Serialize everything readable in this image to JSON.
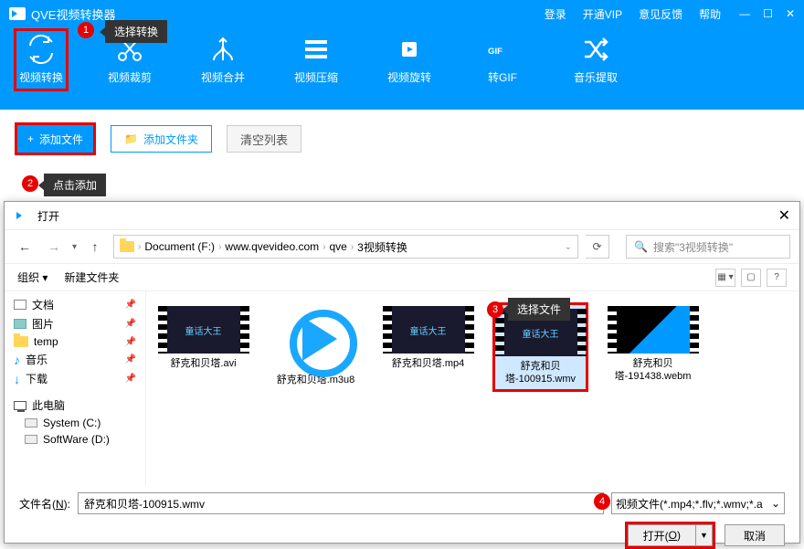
{
  "app_title": "QVE视频转换器",
  "titlebar_links": [
    "登录",
    "开通VIP",
    "意见反馈",
    "帮助"
  ],
  "tips": {
    "t1": "选择转换",
    "t2": "点击添加",
    "t3": "选择文件"
  },
  "badges": {
    "b1": "1",
    "b2": "2",
    "b3": "3",
    "b4": "4"
  },
  "tools": [
    "视频转换",
    "视频裁剪",
    "视频合并",
    "视频压缩",
    "视频旋转",
    "转GIF",
    "音乐提取"
  ],
  "actions": {
    "add": "添加文件",
    "addf": "添加文件夹",
    "clear": "清空列表"
  },
  "dialog": {
    "title": "打开",
    "crumb": [
      "Document (F:)",
      "www.qvevideo.com",
      "qve",
      "3视频转换"
    ],
    "search_ph": "搜索\"3视频转换\"",
    "organize": "组织",
    "newfolder": "新建文件夹",
    "tree": [
      "文档",
      "图片",
      "temp",
      "音乐",
      "下载",
      "此电脑",
      "System (C:)",
      "SoftWare (D:)"
    ],
    "files": [
      {
        "n": "舒克和贝塔.avi",
        "t": "童话大王"
      },
      {
        "n": "舒克和贝塔.m3u8",
        "play": true
      },
      {
        "n": "舒克和贝塔.mp4",
        "t": "童话大王"
      },
      {
        "n": "舒克和贝塔-100915.wmv",
        "t": "童话大王",
        "sel": true
      },
      {
        "n": "舒克和贝塔-191438.webm",
        "t": ""
      }
    ],
    "fname_label": "文件名(",
    "fname_u": "N",
    "fname_label2": "):",
    "fname_value": "舒克和贝塔-100915.wmv",
    "ftype": "视频文件(*.mp4;*.flv;*.wmv;*.a",
    "open": "打开(",
    "open_u": "O",
    "open2": ")",
    "cancel": "取消"
  }
}
